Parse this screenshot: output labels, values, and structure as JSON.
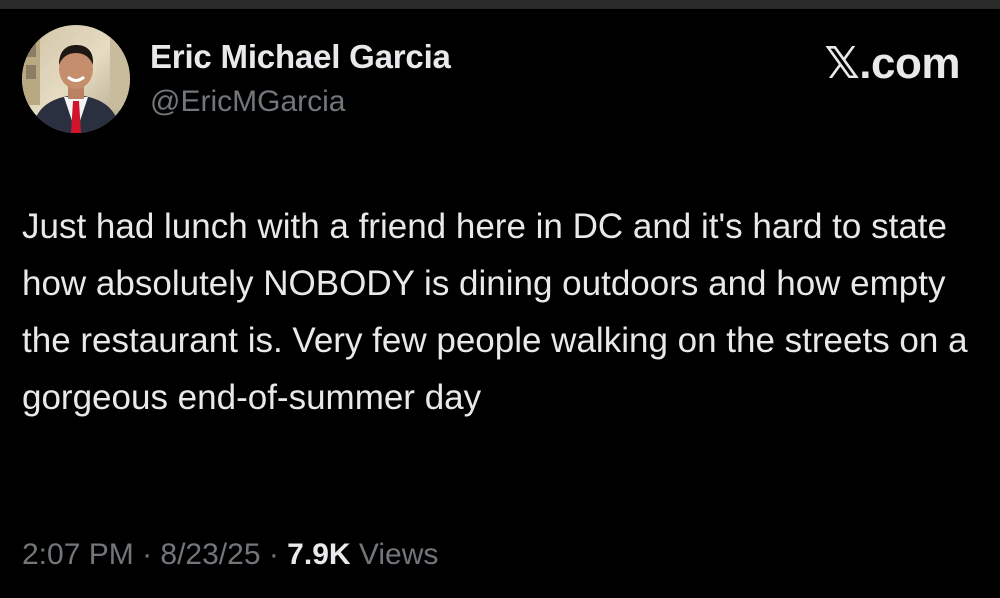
{
  "author": {
    "display_name": "Eric Michael Garcia",
    "handle": "@EricMGarcia",
    "avatar_icon": "profile-photo"
  },
  "brand": {
    "label": "𝕏.com"
  },
  "tweet": {
    "text": "Just had lunch with a friend here in DC and it's hard to state how absolutely NOBODY is dining outdoors and how empty the restaurant is. Very few people walking on the streets on a gorgeous end-of-summer day"
  },
  "meta": {
    "time": "2:07 PM",
    "separator": " · ",
    "date": "8/23/25",
    "views_count": "7.9K",
    "views_label": " Views"
  },
  "colors": {
    "background": "#000000",
    "primary_text": "#e7e9ea",
    "secondary_text": "#71767b",
    "tie": "#d0142c"
  }
}
